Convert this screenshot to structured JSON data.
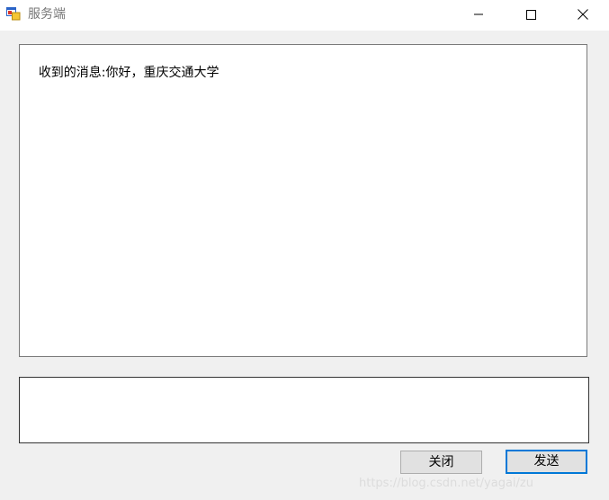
{
  "window": {
    "title": "服务端",
    "app_icon": "windows-form-icon",
    "controls": {
      "minimize": "minimize-icon",
      "maximize": "maximize-icon",
      "close": "close-icon"
    }
  },
  "received": {
    "text": "收到的消息:你好，重庆交通大学"
  },
  "send_input": {
    "value": ""
  },
  "buttons": {
    "close_label": "关闭",
    "send_label": "发送"
  },
  "watermark": "https://blog.csdn.net/yagai/zu",
  "colors": {
    "accent": "#0078d7",
    "background": "#f0f0f0"
  }
}
